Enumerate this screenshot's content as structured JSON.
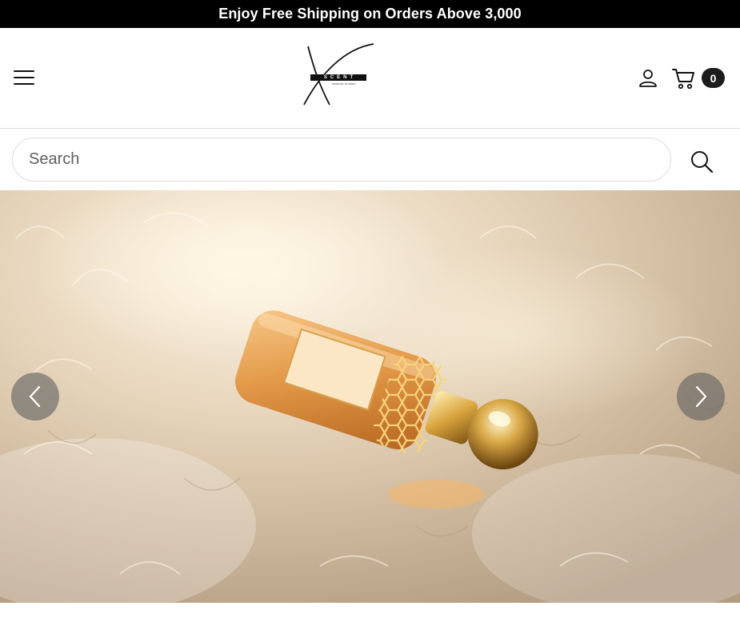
{
  "announcement": {
    "text": "Enjoy Free Shipping on Orders Above 3,000"
  },
  "header": {
    "menu_icon": "hamburger-menu-icon",
    "logo": {
      "wordmark": "SCENT",
      "tagline": "essence of scent"
    },
    "user_icon": "user-icon",
    "cart_icon": "cart-icon",
    "cart_count": "0"
  },
  "search": {
    "placeholder": "Search",
    "value": "",
    "icon": "search-icon"
  },
  "hero": {
    "image": "perfume-bottle-on-fur-photo",
    "prev_icon": "chevron-left-icon",
    "next_icon": "chevron-right-icon"
  },
  "colors": {
    "topbar": "#000000",
    "badge": "#1c1c1c",
    "arrow_bg": "#5f5f5f"
  }
}
